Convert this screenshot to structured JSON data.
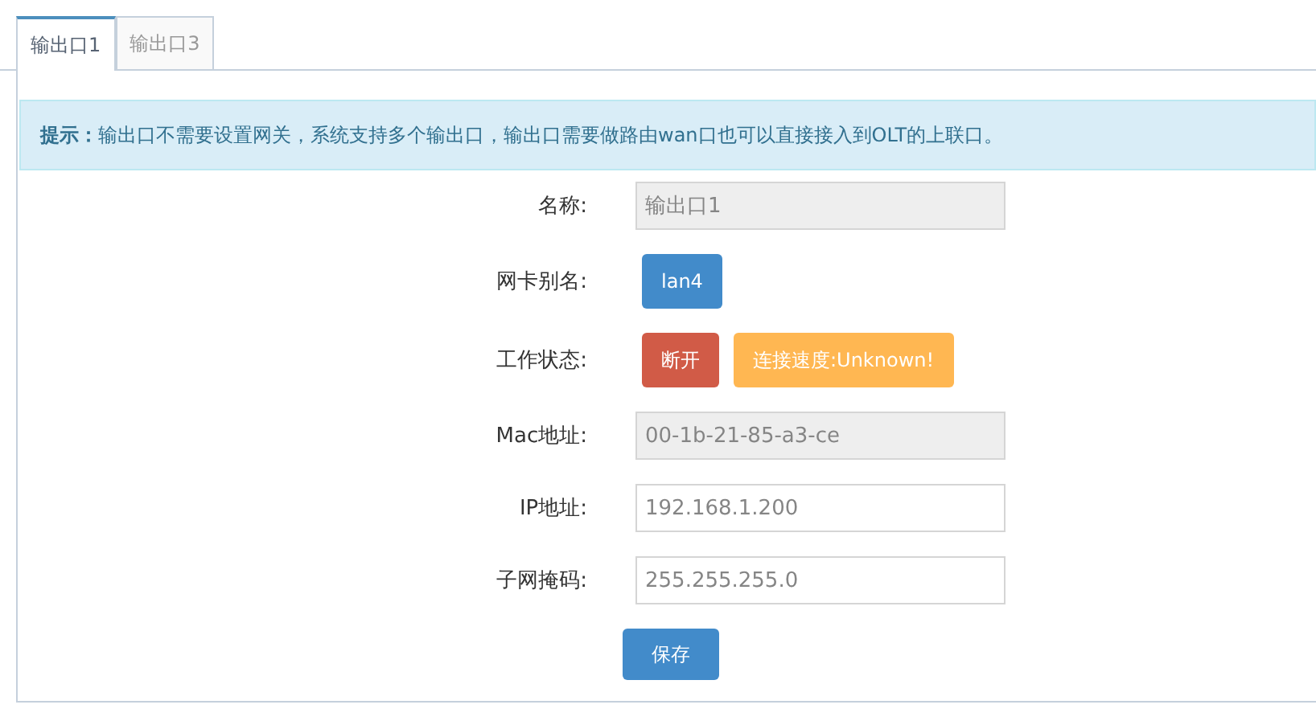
{
  "tabs": [
    {
      "label": "输出口1",
      "selected": true
    },
    {
      "label": "输出口3",
      "selected": false
    }
  ],
  "alert": {
    "label": "提示：",
    "text": "输出口不需要设置网关，系统支持多个输出口，输出口需要做路由wan口也可以直接接入到OLT的上联口。"
  },
  "fields": [
    {
      "label": "名称:",
      "kind": "readonly",
      "value": "输出口1"
    },
    {
      "label": "网卡别名:",
      "kind": "buttons",
      "buttons": [
        {
          "label": "lan4",
          "kind": "primary"
        }
      ]
    },
    {
      "label": "工作状态:",
      "kind": "buttons",
      "buttons": [
        {
          "label": "断开",
          "kind": "danger"
        },
        {
          "label": "连接速度:Unknown!",
          "kind": "warning"
        }
      ]
    },
    {
      "label": "Mac地址:",
      "kind": "readonly",
      "value": "00-1b-21-85-a3-ce"
    },
    {
      "label": "IP地址:",
      "kind": "input",
      "value": "192.168.1.200"
    },
    {
      "label": "子网掩码:",
      "kind": "input",
      "value": "255.255.255.0"
    }
  ],
  "save_button": "保存"
}
